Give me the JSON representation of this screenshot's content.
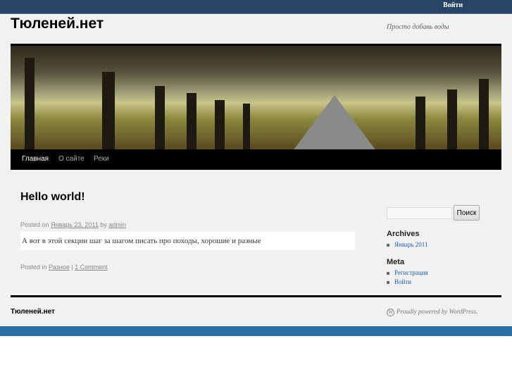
{
  "topbar": {
    "login": "Войти"
  },
  "site": {
    "title": "Тюленей.нет",
    "description": "Просто добавь воды"
  },
  "nav": [
    {
      "label": "Главная"
    },
    {
      "label": "О сайте"
    },
    {
      "label": "Реки"
    }
  ],
  "post": {
    "title": "Hello world!",
    "posted_on": "Posted on",
    "date": "Январь 23, 2011",
    "by": "by",
    "author": "admin",
    "content": "А вот в этой секции шаг за шагом писать про походы, хорошие и разные",
    "posted_in": "Posted in",
    "category": "Разное",
    "sep": "|",
    "comments": "1 Comment"
  },
  "sidebar": {
    "search_placeholder": "",
    "search_button": "Поиск",
    "archives_title": "Archives",
    "archives": [
      "Январь 2011"
    ],
    "meta_title": "Meta",
    "meta": [
      "Регистрация",
      "Войти"
    ]
  },
  "footer": {
    "title": "Тюленей.нет",
    "powered": "Proudly powered by WordPress."
  }
}
